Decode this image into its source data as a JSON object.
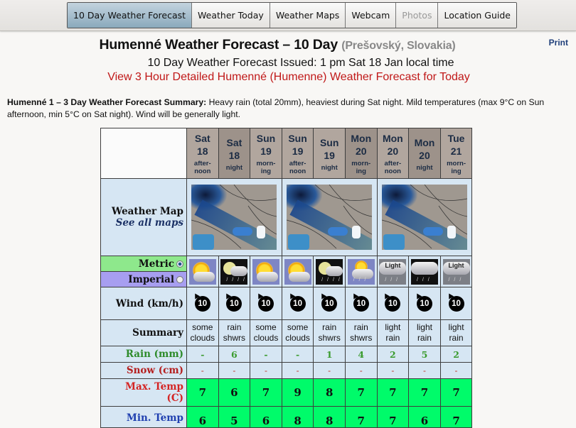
{
  "nav": {
    "tabs": [
      {
        "label": "10 Day Weather Forecast",
        "active": true,
        "disabled": false
      },
      {
        "label": "Weather Today",
        "active": false,
        "disabled": false
      },
      {
        "label": "Weather Maps",
        "active": false,
        "disabled": false
      },
      {
        "label": "Webcam",
        "active": false,
        "disabled": false
      },
      {
        "label": "Photos",
        "active": false,
        "disabled": true
      },
      {
        "label": "Location Guide",
        "active": false,
        "disabled": false
      }
    ]
  },
  "header": {
    "print_label": "Print",
    "title": "Humenné Weather Forecast – 10 Day",
    "region": "(Prešovský, Slovakia)",
    "issued": "10 Day Weather Forecast Issued: 1 pm Sat 18 Jan local time",
    "detail_link": "View 3 Hour Detailed Humenné (Humenne) Weather Forecast for Today"
  },
  "summary": {
    "heading": "Humenné 1 – 3 Day Weather Forecast Summary:",
    "text": " Heavy rain (total 20mm), heaviest during Sat night. Mild temperatures (max 9°C on Sun afternoon, min 5°C on Sat night). Wind will be generally light."
  },
  "table": {
    "labels": {
      "weather_map": "Weather Map",
      "see_all_maps": "See all maps",
      "metric": "Metric",
      "imperial": "Imperial",
      "wind": "Wind (km/h)",
      "summary": "Summary",
      "rain": "Rain (mm)",
      "snow": "Snow (cm)",
      "max_temp": "Max. Temp",
      "max_temp_unit": "(C)",
      "min_temp": "Min. Temp"
    },
    "units_selected": "metric",
    "columns": [
      {
        "day": "Sat",
        "date": "18",
        "period": [
          "after-",
          "noon"
        ],
        "icon": "sun-cloud-icon",
        "icon_text": "",
        "wind": "10",
        "summary": [
          "some",
          "clouds"
        ],
        "rain": "-",
        "snow": "-",
        "max": "7",
        "min": "6"
      },
      {
        "day": "Sat",
        "date": "18",
        "period": [
          "night",
          ""
        ],
        "icon": "moon-rain-icon",
        "icon_text": "",
        "wind": "10",
        "summary": [
          "rain",
          "shwrs"
        ],
        "rain": "6",
        "snow": "-",
        "max": "6",
        "min": "5"
      },
      {
        "day": "Sun",
        "date": "19",
        "period": [
          "morn-",
          "ing"
        ],
        "icon": "sun-cloud-icon",
        "icon_text": "",
        "wind": "10",
        "summary": [
          "some",
          "clouds"
        ],
        "rain": "-",
        "snow": "-",
        "max": "7",
        "min": "6"
      },
      {
        "day": "Sun",
        "date": "19",
        "period": [
          "after-",
          "noon"
        ],
        "icon": "sun-cloud-icon",
        "icon_text": "",
        "wind": "10",
        "summary": [
          "some",
          "clouds"
        ],
        "rain": "-",
        "snow": "-",
        "max": "9",
        "min": "8"
      },
      {
        "day": "Sun",
        "date": "19",
        "period": [
          "night",
          ""
        ],
        "icon": "moon-rain-icon",
        "icon_text": "",
        "wind": "10",
        "summary": [
          "rain",
          "shwrs"
        ],
        "rain": "1",
        "snow": "-",
        "max": "8",
        "min": "8"
      },
      {
        "day": "Mon",
        "date": "20",
        "period": [
          "morn-",
          "ing"
        ],
        "icon": "sun-cloud-rain-icon",
        "icon_text": "",
        "wind": "10",
        "summary": [
          "rain",
          "shwrs"
        ],
        "rain": "4",
        "snow": "-",
        "max": "7",
        "min": "7"
      },
      {
        "day": "Mon",
        "date": "20",
        "period": [
          "after-",
          "noon"
        ],
        "icon": "light-rain-icon",
        "icon_text": "Light",
        "wind": "10",
        "summary": [
          "light",
          "rain"
        ],
        "rain": "2",
        "snow": "-",
        "max": "7",
        "min": "7"
      },
      {
        "day": "Mon",
        "date": "20",
        "period": [
          "night",
          ""
        ],
        "icon": "night-rain-icon",
        "icon_text": "",
        "wind": "10",
        "summary": [
          "light",
          "rain"
        ],
        "rain": "5",
        "snow": "-",
        "max": "7",
        "min": "6"
      },
      {
        "day": "Tue",
        "date": "21",
        "period": [
          "morn-",
          "ing"
        ],
        "icon": "light-rain-icon",
        "icon_text": "Light",
        "wind": "10",
        "summary": [
          "light",
          "rain"
        ],
        "rain": "2",
        "snow": "-",
        "max": "7",
        "min": "7"
      }
    ],
    "maps": [
      {
        "name": "weather-map-1"
      },
      {
        "name": "weather-map-2"
      },
      {
        "name": "weather-map-3"
      }
    ]
  }
}
